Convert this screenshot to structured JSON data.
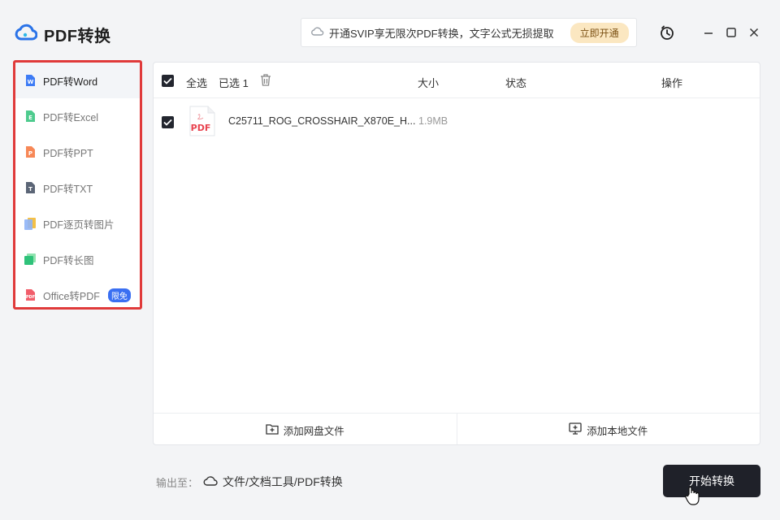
{
  "app": {
    "title": "PDF转换",
    "brand_color": "#2a73e8"
  },
  "promo": {
    "text": "开通SVIP享无限次PDF转换，文字公式无损提取",
    "button": "立即开通"
  },
  "window_controls": [
    "history-icon",
    "minimize-icon",
    "maximize-icon",
    "close-icon"
  ],
  "sidebar": {
    "items": [
      {
        "label": "PDF转Word",
        "icon": "word-icon",
        "color": "#3d7bf5",
        "active": true
      },
      {
        "label": "PDF转Excel",
        "icon": "excel-icon",
        "color": "#2fc27a"
      },
      {
        "label": "PDF转PPT",
        "icon": "ppt-icon",
        "color": "#f67b45"
      },
      {
        "label": "PDF转TXT",
        "icon": "txt-icon",
        "color": "#5b6576"
      },
      {
        "label": "PDF逐页转图片",
        "icon": "pages-to-image-icon",
        "color": "#f4c046"
      },
      {
        "label": "PDF转长图",
        "icon": "long-image-icon",
        "color": "#2fc27a"
      },
      {
        "label": "Office转PDF",
        "icon": "office-pdf-icon",
        "color": "#ef4b5a",
        "badge": "限免"
      }
    ]
  },
  "table": {
    "select_all": "全选",
    "selected": "已选 1",
    "columns": {
      "size": "大小",
      "status": "状态",
      "actions": "操作"
    },
    "rows": [
      {
        "name": "C25711_ROG_CROSSHAIR_X870E_H...",
        "size": "1.9MB",
        "status": "",
        "file_icon_label": "PDF",
        "checked": true
      }
    ]
  },
  "footer": {
    "add_cloud": "添加网盘文件",
    "add_local": "添加本地文件"
  },
  "output": {
    "label": "输出至：",
    "path": "文件/文档工具/PDF转换"
  },
  "start_button": "开始转换"
}
